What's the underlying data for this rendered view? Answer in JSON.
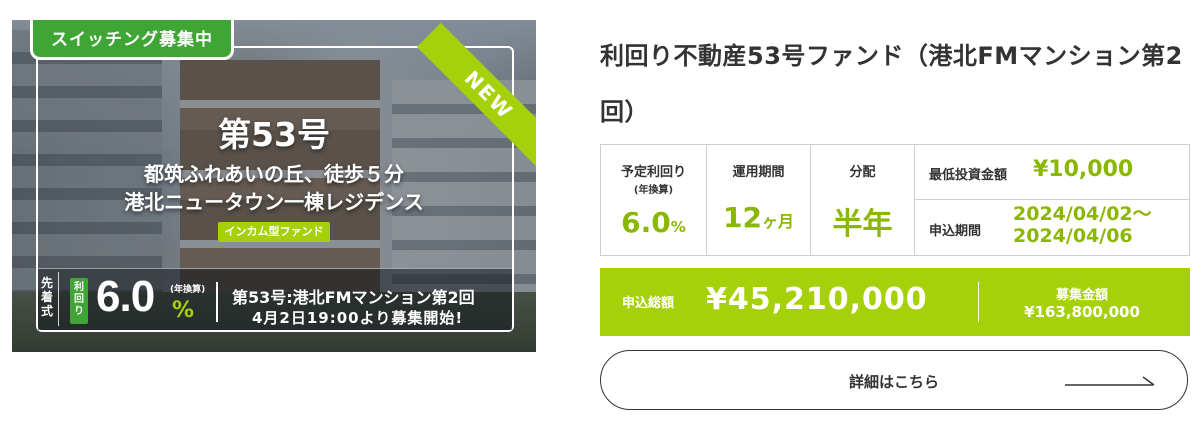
{
  "banner": {
    "switch_badge": "スイッチング募集中",
    "new_badge": "NEW",
    "fund_number": "第53号",
    "subtitle_line1": "都筑ふれあいの丘、徒歩５分",
    "subtitle_line2": "港北ニュータウン一棟レジデンス",
    "type_tag": "インカム型ファンド",
    "method_label": "先着式",
    "yield_tag": "利回り",
    "yield_value": "6.0",
    "yield_unit": "%",
    "yield_note": "(年換算)",
    "line1": "第53号:港北FMマンション第2回",
    "line2": "4月2日19:00より募集開始!"
  },
  "fund": {
    "title": "利回り不動産53号ファンド（港北FMマンション第2回）"
  },
  "info": {
    "expected_yield_label": "予定利回り",
    "expected_yield_note": "(年換算)",
    "expected_yield_value": "6.0",
    "expected_yield_unit": "%",
    "period_label": "運用期間",
    "period_value": "12",
    "period_unit": "ヶ月",
    "distribution_label": "分配",
    "distribution_value": "半年",
    "min_invest_label": "最低投資金額",
    "min_invest_value": "¥10,000",
    "apply_period_label": "申込期間",
    "apply_period_start": "2024/04/02〜",
    "apply_period_end": "2024/04/06"
  },
  "totals": {
    "applied_label": "申込総額",
    "applied_value": "¥45,210,000",
    "goal_label": "募集金額",
    "goal_value": "¥163,800,000"
  },
  "detail_button": {
    "label": "詳細はこちら"
  },
  "colors": {
    "accent_green": "#a6d10a",
    "badge_green": "#3fa535",
    "value_green": "#8ab800"
  }
}
